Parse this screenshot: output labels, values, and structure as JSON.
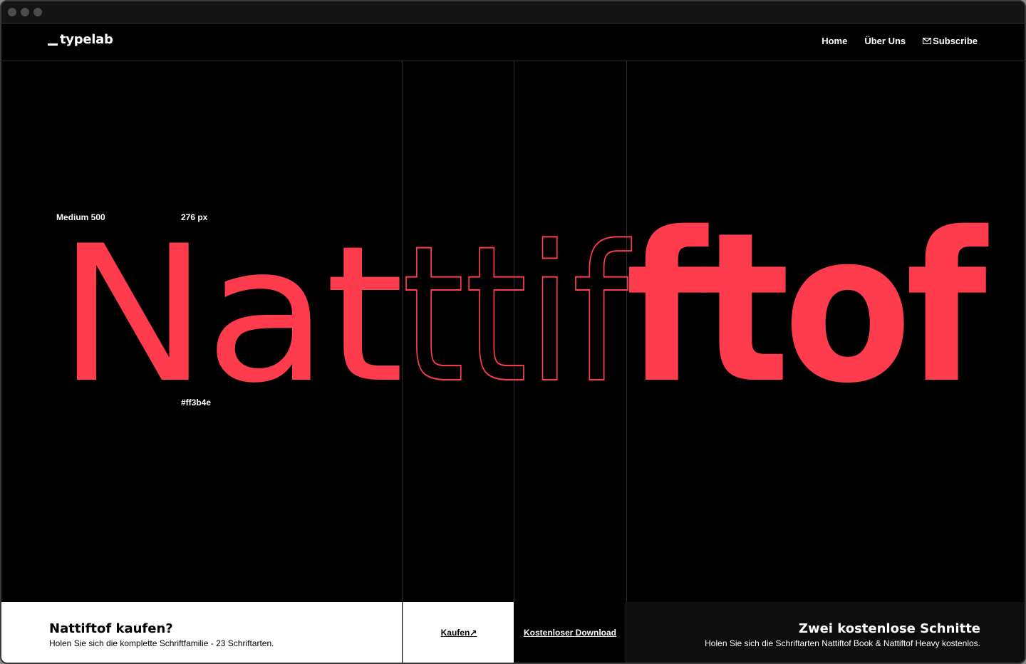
{
  "nav": {
    "logo": "typelab",
    "links": [
      {
        "label": "Home"
      },
      {
        "label": "Über Uns"
      },
      {
        "label": "Subscribe",
        "icon": "mail-icon"
      }
    ]
  },
  "specimen": {
    "weight": "Medium 500",
    "size": "276 px",
    "color": "#ff3b4e",
    "word_medium": "Nat",
    "word_thin": "ttif",
    "word_heavy": "ftof"
  },
  "footer": {
    "buy": {
      "title": "Nattiftof kaufen?",
      "subtitle": "Holen Sie sich die komplette Schriftfamilie - 23 Schriftarten.",
      "button": "Kaufen↗"
    },
    "download": {
      "button": "Kostenloser Download"
    },
    "free": {
      "title": "Zwei kostenlose Schnitte",
      "subtitle": "Holen Sie sich die Schriftarten Nattiftof Book & Nattiftof Heavy kostenlos."
    }
  },
  "colors": {
    "accent": "#ff3b4e",
    "background": "#000000"
  }
}
